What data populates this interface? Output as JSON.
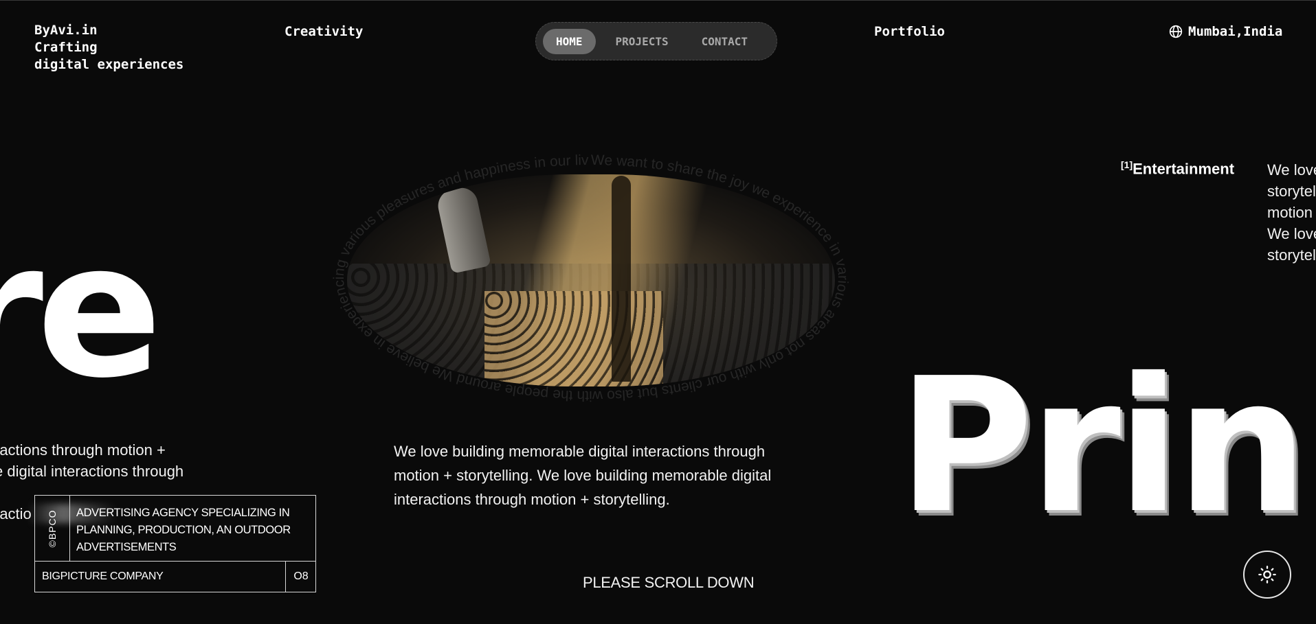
{
  "header": {
    "brand_lines": [
      "ByAvi.in",
      "Crafting",
      "digital experiences"
    ],
    "creativity": "Creativity",
    "portfolio": "Portfolio",
    "location": "Mumbai,India",
    "location_icon": "globe-icon"
  },
  "nav": {
    "items": [
      "HOME",
      "PROJECTS",
      "CONTACT"
    ],
    "active": "HOME"
  },
  "hero": {
    "big_text_left": "re",
    "big_text_right": "Prin",
    "circle_text": "We want to share the joy we experience in various areas not only with our clients but also with the people around We believe in experiencing various pleasures and happiness in our lives.",
    "left_para_lines": [
      "ractions through motion +",
      "e digital interactions through",
      "",
      "ractio"
    ],
    "mid_para": "We love building memorable digital interactions through motion + storytelling. We love building memorable digital interactions through motion + storytelling.",
    "scroll_label": "PLEASE SCROLL DOWN"
  },
  "info_card": {
    "vertical_label": "©BPCO",
    "description": "ADVERTISING AGENCY SPECIALIZING IN PLANNING, PRODUCTION, AN OUTDOOR ADVERTISEMENTS",
    "company": "BIGPICTURE COMPANY",
    "number": "O8"
  },
  "entertainment": {
    "index": "[1]",
    "label": "Entertainment",
    "para_lines": [
      "We love",
      "storytel",
      "motion",
      "We love",
      "storytel"
    ]
  },
  "theme_toggle": {
    "icon": "sun-icon"
  },
  "colors": {
    "background": "#0a0a0a",
    "nav_bg": "#2b2b2b",
    "nav_active": "#6b6b6b",
    "text": "#ffffff"
  }
}
